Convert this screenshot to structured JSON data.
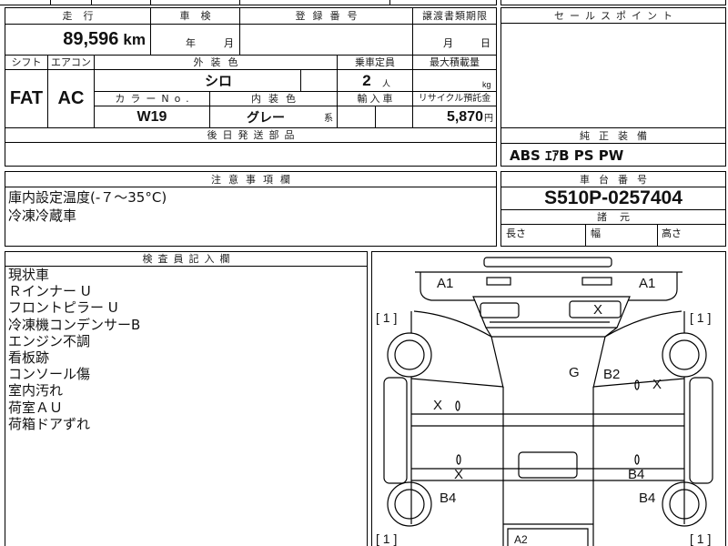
{
  "sheet": {
    "mileage": {
      "label": "走行",
      "value": "89,596",
      "unit": "km"
    },
    "inspection": {
      "label": "車検",
      "year_unit": "年",
      "month_unit": "月"
    },
    "registration": {
      "label": "登録番号"
    },
    "transfer_deadline": {
      "label": "譲渡書類期限",
      "month_unit": "月",
      "day_unit": "日"
    },
    "shift": {
      "label": "シフト",
      "value": "FAT"
    },
    "aircon": {
      "label": "エアコン",
      "value": "AC"
    },
    "exterior_color": {
      "label": "外装色",
      "value": "シロ"
    },
    "capacity": {
      "label": "乗車定員",
      "value": "2",
      "unit": "人"
    },
    "max_load": {
      "label": "最大積載量",
      "unit": "kg"
    },
    "color_no": {
      "label": "カラーNo.",
      "value": "W19"
    },
    "interior_color": {
      "label": "内装色",
      "value": "グレー",
      "suffix": "系"
    },
    "imported": {
      "label": "輸入車"
    },
    "recycle_deposit": {
      "label": "リサイクル預託金",
      "value": "5,870",
      "unit": "円"
    },
    "parts_later": {
      "label": "後日発送部品"
    }
  },
  "sales_point": {
    "label": "セールスポイント"
  },
  "equipment": {
    "label": "純正装備",
    "value": "ABS ｴｱB PS PW"
  },
  "cautions": {
    "label": "注意事項欄",
    "lines": [
      "庫内設定温度(-７～35°C)",
      "冷凍冷蔵車"
    ]
  },
  "chassis": {
    "label": "車台番号",
    "value": "S510P-0257404"
  },
  "specs": {
    "label": "諸元",
    "length_label": "長さ",
    "width_label": "幅",
    "height_label": "高さ"
  },
  "inspector": {
    "label": "検査員記入欄",
    "lines": [
      "現状車",
      "Ｒインナー U",
      "フロントピラー U",
      "冷凍機コンデンサーB",
      "エンジン不調",
      "看板跡",
      "コンソール傷",
      "室内汚れ",
      "荷室ＡＵ",
      "荷箱ドアずれ"
    ]
  },
  "diagram": {
    "tires": {
      "front_left": "[ 1 ]",
      "front_right": "[ 1 ]",
      "rear_left": "[ 1 ]",
      "rear_right": "[ 1 ]"
    },
    "marks": {
      "front_left": "A1",
      "front_right": "A1",
      "windshield": "X",
      "roof": "G",
      "roof_right": "B2",
      "left_door": "X",
      "right_door": "X",
      "left_side_rear": "X",
      "right_side_rear": "B4",
      "left_rear_fender": "B4",
      "right_rear_fender": "B4",
      "rear": "A2"
    }
  }
}
